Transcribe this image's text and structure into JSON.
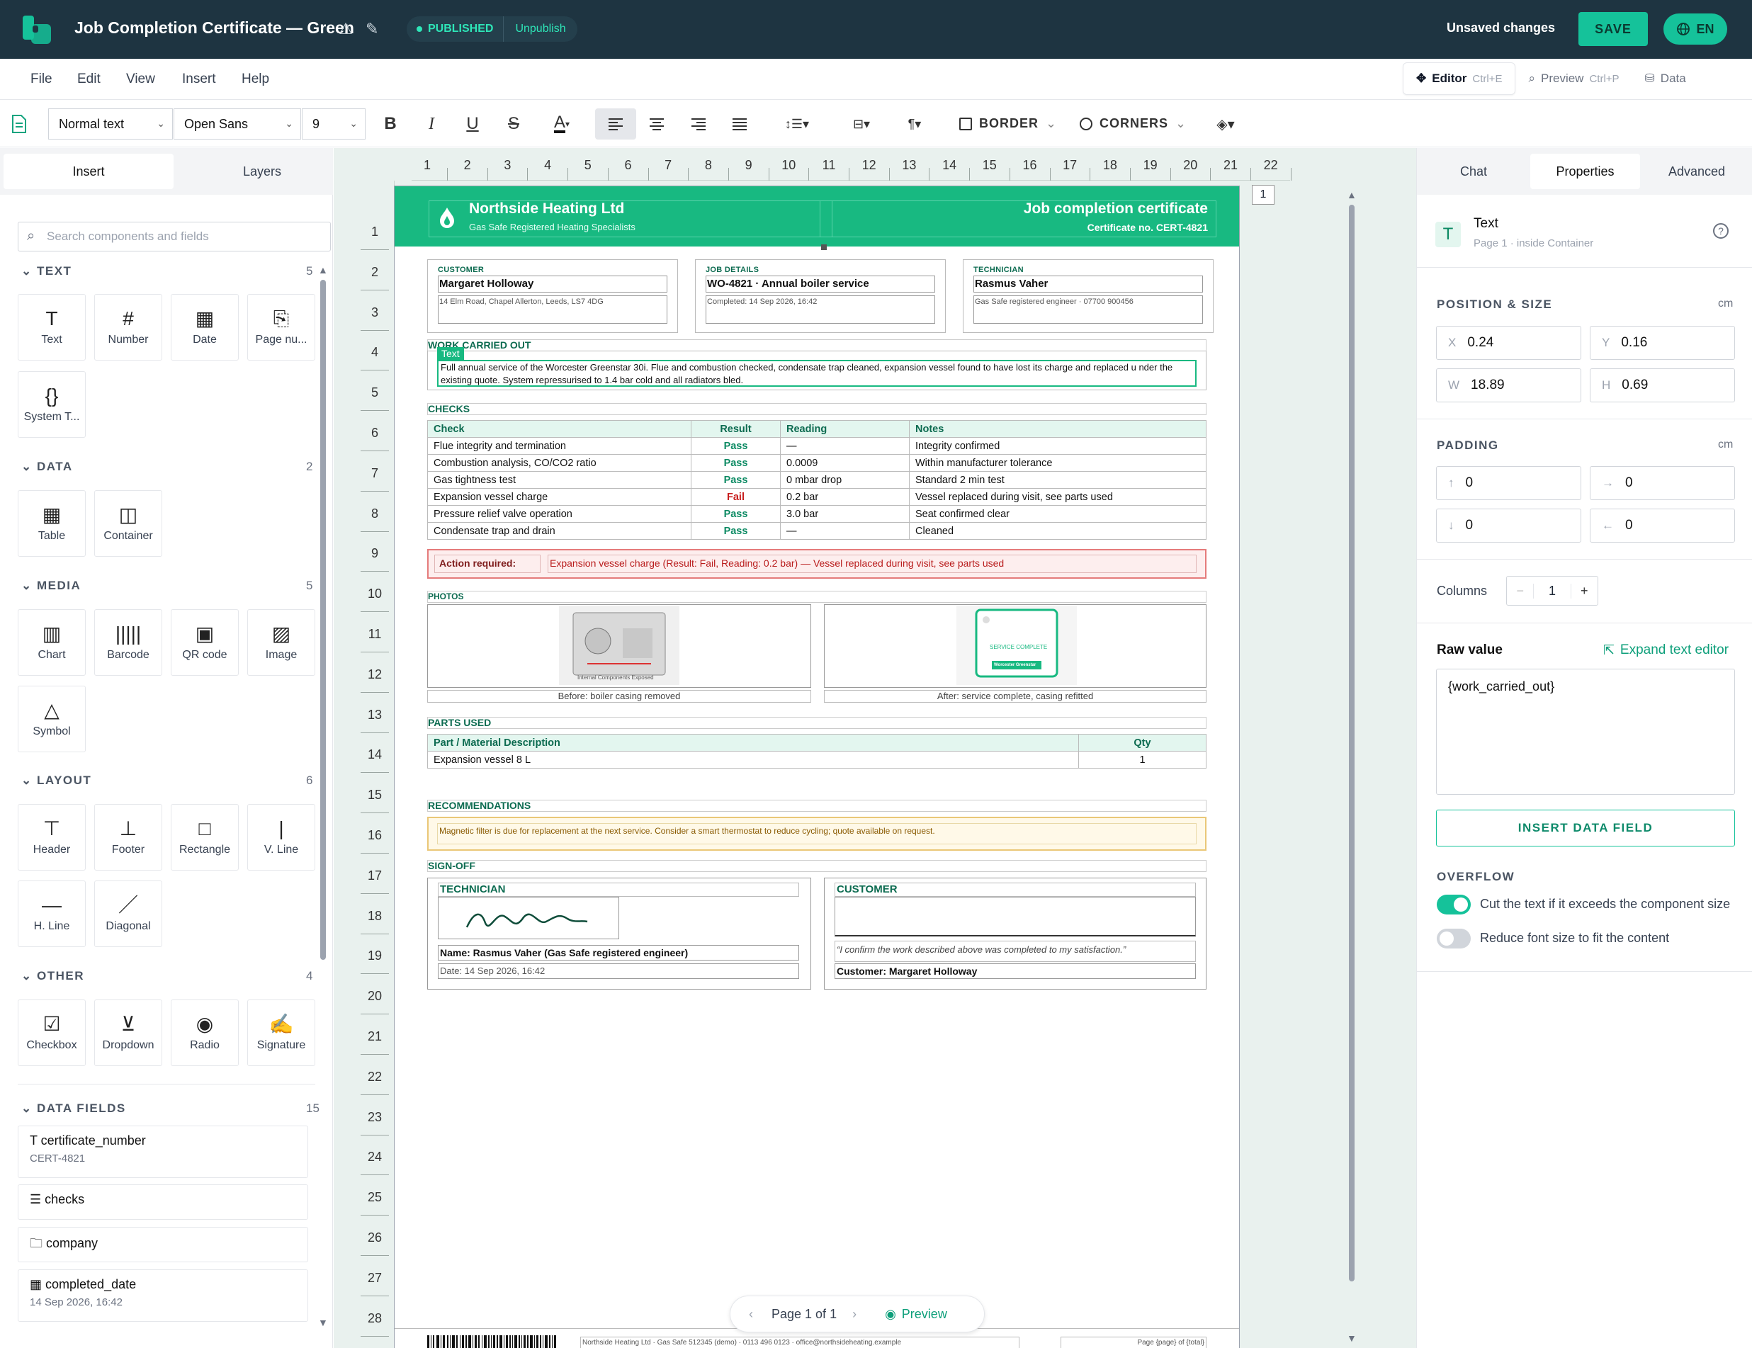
{
  "app": {
    "doc_title": "Job Completion Certificate — Green",
    "status": "PUBLISHED",
    "unpublish": "Unpublish",
    "unsaved": "Unsaved changes",
    "save": "SAVE",
    "lang": "EN"
  },
  "menu": [
    "File",
    "Edit",
    "View",
    "Insert",
    "Help"
  ],
  "modes": {
    "editor": "Editor",
    "editor_kbd": "Ctrl+E",
    "preview": "Preview",
    "preview_kbd": "Ctrl+P",
    "data": "Data"
  },
  "toolbar": {
    "style": "Normal text",
    "font": "Open Sans",
    "size": "9",
    "border": "BORDER",
    "corners": "CORNERS"
  },
  "left": {
    "tabs": [
      "Insert",
      "Layers"
    ],
    "search_placeholder": "Search components and fields",
    "sections": {
      "text": {
        "title": "TEXT",
        "count": "5",
        "items": [
          "Text",
          "Number",
          "Date",
          "Page nu...",
          "System T..."
        ]
      },
      "data": {
        "title": "DATA",
        "count": "2",
        "items": [
          "Table",
          "Container"
        ]
      },
      "media": {
        "title": "MEDIA",
        "count": "5",
        "items": [
          "Chart",
          "Barcode",
          "QR code",
          "Image",
          "Symbol"
        ]
      },
      "layout": {
        "title": "LAYOUT",
        "count": "6",
        "items": [
          "Header",
          "Footer",
          "Rectangle",
          "V. Line",
          "H. Line",
          "Diagonal"
        ]
      },
      "other": {
        "title": "OTHER",
        "count": "4",
        "items": [
          "Checkbox",
          "Dropdown",
          "Radio",
          "Signature"
        ]
      },
      "fields": {
        "title": "DATA FIELDS",
        "count": "15"
      }
    },
    "data_fields": [
      {
        "name": "certificate_number",
        "value": "CERT-4821"
      },
      {
        "name": "checks",
        "value": ""
      },
      {
        "name": "company",
        "value": ""
      },
      {
        "name": "completed_date",
        "value": "14 Sep 2026, 16:42"
      }
    ]
  },
  "ruler": {
    "h": [
      "1",
      "2",
      "3",
      "4",
      "5",
      "6",
      "7",
      "8",
      "9",
      "10",
      "11",
      "12",
      "13",
      "14",
      "15",
      "16",
      "17",
      "18",
      "19",
      "20",
      "21",
      "22"
    ],
    "v": [
      "1",
      "2",
      "3",
      "4",
      "5",
      "6",
      "7",
      "8",
      "9",
      "10",
      "11",
      "12",
      "13",
      "14",
      "15",
      "16",
      "17",
      "18",
      "19",
      "20",
      "21",
      "22",
      "23",
      "24",
      "25",
      "26",
      "27",
      "28"
    ],
    "page_marker": "1"
  },
  "doc": {
    "company": "Northside Heating Ltd",
    "company_sub": "Gas Safe Registered Heating Specialists",
    "cert_title": "Job completion certificate",
    "cert_no": "Certificate no. CERT-4821",
    "customer_label": "CUSTOMER",
    "customer_name": "Margaret Holloway",
    "customer_addr": "14 Elm Road, Chapel Allerton, Leeds, LS7 4DG",
    "job_label": "JOB DETAILS",
    "job_name": "WO-4821 · Annual boiler service",
    "job_completed": "Completed: 14 Sep 2026, 16:42",
    "tech_label": "TECHNICIAN",
    "tech_name": "Rasmus Vaher",
    "tech_sub": "Gas Safe registered engineer · 07700 900456",
    "work_title": "WORK CARRIED OUT",
    "selected_tag": "Text",
    "work_text": "Full annual service of the Worcester Greenstar 30i. Flue and combustion checked, condensate trap cleaned, expansion vessel found to have lost its charge and replaced u nder the existing quote. System repressurised to 1.4 bar cold and all radiators bled.",
    "checks_title": "CHECKS",
    "checks_headers": [
      "Check",
      "Result",
      "Reading",
      "Notes"
    ],
    "checks_rows": [
      [
        "Flue integrity and termination",
        "Pass",
        "—",
        "Integrity confirmed"
      ],
      [
        "Combustion analysis, CO/CO2 ratio",
        "Pass",
        "0.0009",
        "Within manufacturer tolerance"
      ],
      [
        "Gas tightness test",
        "Pass",
        "0 mbar drop",
        "Standard 2 min test"
      ],
      [
        "Expansion vessel charge",
        "Fail",
        "0.2 bar",
        "Vessel replaced during visit, see parts used"
      ],
      [
        "Pressure relief valve operation",
        "Pass",
        "3.0 bar",
        "Seat confirmed clear"
      ],
      [
        "Condensate trap and drain",
        "Pass",
        "—",
        "Cleaned"
      ]
    ],
    "action_label": "Action required:",
    "action_text": "Expansion vessel charge (Result: Fail, Reading: 0.2 bar) — Vessel replaced during visit, see parts used",
    "photos_title": "PHOTOS",
    "photo1_caption": "Before: boiler casing removed",
    "photo1_inner": "Internal Components Exposed",
    "photo2_caption": "After: service complete, casing refitted",
    "photo2_inner": "SERVICE COMPLETE",
    "photo2_brand": "Worcester Greenstar",
    "parts_title": "PARTS USED",
    "parts_headers": [
      "Part / Material Description",
      "Qty"
    ],
    "parts_rows": [
      [
        "Expansion vessel 8 L",
        "1"
      ]
    ],
    "rec_title": "RECOMMENDATIONS",
    "rec_text": "Magnetic filter is due for replacement at the next service. Consider a smart thermostat to reduce cycling; quote available on request.",
    "signoff_title": "SIGN-OFF",
    "so_tech_label": "TECHNICIAN",
    "so_tech_name": "Name: Rasmus Vaher (Gas Safe registered engineer)",
    "so_tech_date": "Date: 14 Sep 2026, 16:42",
    "so_cust_label": "CUSTOMER",
    "so_cust_quote": "“I confirm the work described above was completed to my satisfaction.”",
    "so_cust_name": "Customer: Margaret Holloway",
    "footer_text": "Northside Heating Ltd · Gas Safe 512345 (demo) · 0113 496 0123 · office@northsideheating.example",
    "footer_page": "Page {page} of {total}"
  },
  "pager": {
    "label": "Page 1 of 1",
    "preview": "Preview"
  },
  "right": {
    "tabs": [
      "Chat",
      "Properties",
      "Advanced"
    ],
    "comp_name": "Text",
    "comp_sub": "Page 1 · inside Container",
    "pos_title": "POSITION & SIZE",
    "unit": "cm",
    "x_label": "X",
    "x": "0.24",
    "y_label": "Y",
    "y": "0.16",
    "w_label": "W",
    "w": "18.89",
    "h_label": "H",
    "h": "0.69",
    "padding_title": "PADDING",
    "pad_top": "0",
    "pad_right": "0",
    "pad_bottom": "0",
    "pad_left": "0",
    "columns_label": "Columns",
    "columns": "1",
    "raw_label": "Raw value",
    "expand": "Expand text editor",
    "raw_value": "{work_carried_out}",
    "insert_field": "INSERT DATA FIELD",
    "overflow_title": "OVERFLOW",
    "overflow_cut": "Cut the text if it exceeds the component size",
    "overflow_cut_on": true,
    "overflow_reduce": "Reduce font size to fit the content",
    "overflow_reduce_on": false
  },
  "colors": {
    "brand": "#18b981",
    "topbar": "#1e3441",
    "accent": "#15c29a",
    "fail": "#c81e1e"
  }
}
